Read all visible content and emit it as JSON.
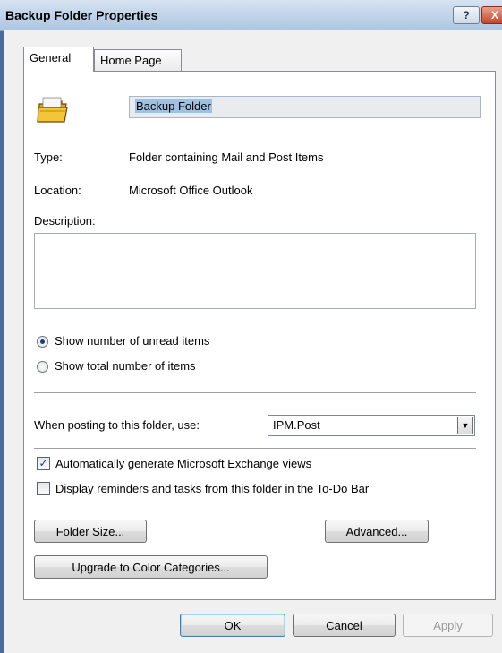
{
  "window": {
    "title": "Backup Folder Properties"
  },
  "titlebar_buttons": {
    "help": "?",
    "close": "X"
  },
  "tabs": [
    {
      "label": "General"
    },
    {
      "label": "Home Page"
    }
  ],
  "general": {
    "name_value": "Backup Folder",
    "type_label": "Type:",
    "type_value": "Folder containing Mail and Post Items",
    "location_label": "Location:",
    "location_value": "Microsoft Office Outlook",
    "description_label": "Description:",
    "description_value": "",
    "radio_unread": "Show number of unread items",
    "radio_total": "Show total number of items",
    "posting_label": "When posting to this folder, use:",
    "posting_value": "IPM.Post",
    "check_exchange": "Automatically generate Microsoft Exchange views",
    "check_reminders": "Display reminders and tasks from this folder in the To-Do Bar",
    "folder_size_button": "Folder Size...",
    "advanced_button": "Advanced...",
    "upgrade_button": "Upgrade to Color Categories..."
  },
  "footer": {
    "ok": "OK",
    "cancel": "Cancel",
    "apply": "Apply"
  },
  "colors": {
    "title_gradient_top": "#d6e3f1",
    "close_red": "#c8442b",
    "frame": "#4a6d97"
  }
}
